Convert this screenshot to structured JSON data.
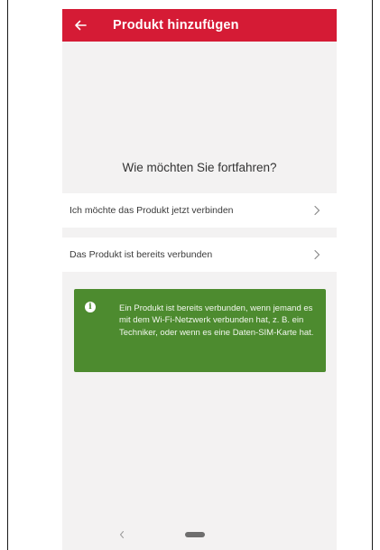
{
  "header": {
    "title": "Produkt hinzufügen",
    "back_icon": "arrow-left-icon"
  },
  "main": {
    "question": "Wie möchten Sie fortfahren?",
    "options": [
      {
        "label": "Ich möchte das Produkt jetzt verbinden",
        "icon": "chevron-right-icon"
      },
      {
        "label": "Das Produkt ist bereits verbunden",
        "icon": "chevron-right-icon"
      }
    ],
    "info": {
      "icon": "info-icon",
      "text": "Ein Produkt ist bereits verbunden, wenn jemand es mit dem Wi-Fi-Netzwerk verbunden hat, z. B. ein Techniker, oder wenn es eine Daten-SIM-Karte hat."
    }
  },
  "colors": {
    "app_bar": "#d51b35",
    "info_box": "#4d8b2f",
    "background": "#f3f2f2"
  },
  "nav": {
    "back_icon": "nav-back-icon",
    "home_icon": "home-pill-icon"
  }
}
